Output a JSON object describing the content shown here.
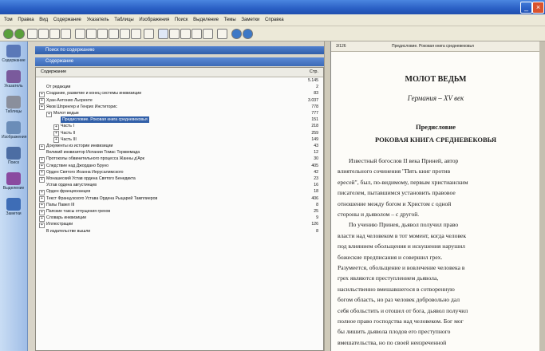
{
  "menu": [
    "Том",
    "Правка",
    "Вид",
    "Содержание",
    "Указатель",
    "Таблицы",
    "Изображения",
    "Поиск",
    "Выделение",
    "Темы",
    "Заметки",
    "Справка"
  ],
  "left_nav": [
    {
      "label": "Содержание",
      "icon": "book-icon",
      "color": "#5a78b8"
    },
    {
      "label": "Указатель",
      "icon": "index-icon",
      "color": "#7a5a9c"
    },
    {
      "label": "Таблицы",
      "icon": "table-icon",
      "color": "#8a8f9c"
    },
    {
      "label": "Изображения",
      "icon": "image-icon",
      "color": "#6b8db8"
    },
    {
      "label": "Поиск",
      "icon": "search-icon",
      "color": "#4c6da3"
    },
    {
      "label": "Выделение",
      "icon": "highlight-icon",
      "color": "#8a4aa0"
    },
    {
      "label": "Заметки",
      "icon": "notes-icon",
      "color": "#3e6db6"
    }
  ],
  "panel": {
    "search_title": "Поиск по содержанию",
    "contents_title": "Содержание",
    "col_title": "Содержание",
    "col_page": "Стр."
  },
  "toc": [
    {
      "label": "",
      "page": "5.145",
      "level": 0,
      "expand": false
    },
    {
      "label": "От редакции",
      "page": "2",
      "level": 0,
      "expand": false
    },
    {
      "label": "Создание, развитие и конец системы инквизиции",
      "page": "83",
      "level": 0,
      "expand": true
    },
    {
      "label": "Хуан-Антонио Льоренте",
      "page": "3.037",
      "level": 0,
      "expand": true
    },
    {
      "label": "Яков Шпренгер и Генрих Инститорис",
      "page": "778",
      "level": 0,
      "expand": true
    },
    {
      "label": "Молот ведьм",
      "page": "777",
      "level": 1,
      "expand": true
    },
    {
      "label": "Предисловие. Роковая книга средневековья",
      "page": "151",
      "level": 2,
      "expand": false,
      "selected": true
    },
    {
      "label": "Часть I",
      "page": "218",
      "level": 2,
      "expand": true
    },
    {
      "label": "Часть II",
      "page": "259",
      "level": 2,
      "expand": true
    },
    {
      "label": "Часть III",
      "page": "149",
      "level": 2,
      "expand": true
    },
    {
      "label": "Документы из истории инквизиции",
      "page": "43",
      "level": 0,
      "expand": true
    },
    {
      "label": "Великий инквизитор Испании Томас Торквемада",
      "page": "12",
      "level": 0,
      "expand": false
    },
    {
      "label": "Протоколы обвинительного процесса Жанны д'Арк",
      "page": "30",
      "level": 0,
      "expand": true
    },
    {
      "label": "Следствие над Джордано Бруно",
      "page": "405",
      "level": 0,
      "expand": true
    },
    {
      "label": "Орден Святого Иоанна Иерусалимского",
      "page": "42",
      "level": 0,
      "expand": true
    },
    {
      "label": "Монашеский Устав ордена Святого Бенедикта",
      "page": "23",
      "level": 0,
      "expand": true
    },
    {
      "label": "Устав ордена августинцев",
      "page": "16",
      "level": 0,
      "expand": false
    },
    {
      "label": "Орден францисканцев",
      "page": "18",
      "level": 0,
      "expand": true
    },
    {
      "label": "Текст Французского Устава Ордена Рыцарей Тамплиеров",
      "page": "406",
      "level": 0,
      "expand": true
    },
    {
      "label": "Папы Павел III",
      "page": "8",
      "level": 0,
      "expand": true
    },
    {
      "label": "Папские таксы отпущения грехов",
      "page": "25",
      "level": 0,
      "expand": true
    },
    {
      "label": "Словарь инквизиции",
      "page": "9",
      "level": 0,
      "expand": true
    },
    {
      "label": "Иллюстрации",
      "page": "126",
      "level": 0,
      "expand": true
    },
    {
      "label": "В издательстве вышли",
      "page": "8",
      "level": 0,
      "expand": false
    }
  ],
  "doc": {
    "page_indicator": "3/126",
    "header_title": "Предисловие. Роковая книга средневековья",
    "book_title": "МОЛОТ ВЕДЬМ",
    "book_subtitle": "Германия – XV век",
    "section": "Предисловие",
    "chapter": "РОКОВАЯ КНИГА СРЕДНЕВЕКОВЬЯ",
    "lines": [
      "Известный богослов II века Приней, автор",
      "влиятельного сочинения \"Пять книг против",
      "ересей\", был, по-видимому, первым христианским",
      "писателем, пытавшимся установить правовое",
      "отношение между богом и Христом с одной",
      "стороны и дьяволом – с другой.",
      "По учению Принея, дьявол получил право",
      "власти над человеком в тот момент, когда человек",
      "под влиянием обольщения и искушения нарушил",
      "божеские предписания и совершил грех.",
      "Разумеется, обольщение и вовлечение человека в",
      "грех являются преступлением дьявола,",
      "насильственно вмешавшегося в сотворенную",
      "богом область, но раз человек добровольно дал",
      "себя обольстить и отошел от бога, дьявол получил",
      "полное право господства над человеком. Бог мог",
      "бы лишить дьявола плодов его преступного",
      "вмешательства, но по своей неизреченной"
    ]
  },
  "colors": {
    "accent": "#315fa8",
    "titlebar": "#2a5fc4",
    "panel_bg": "#fbfbfa"
  }
}
